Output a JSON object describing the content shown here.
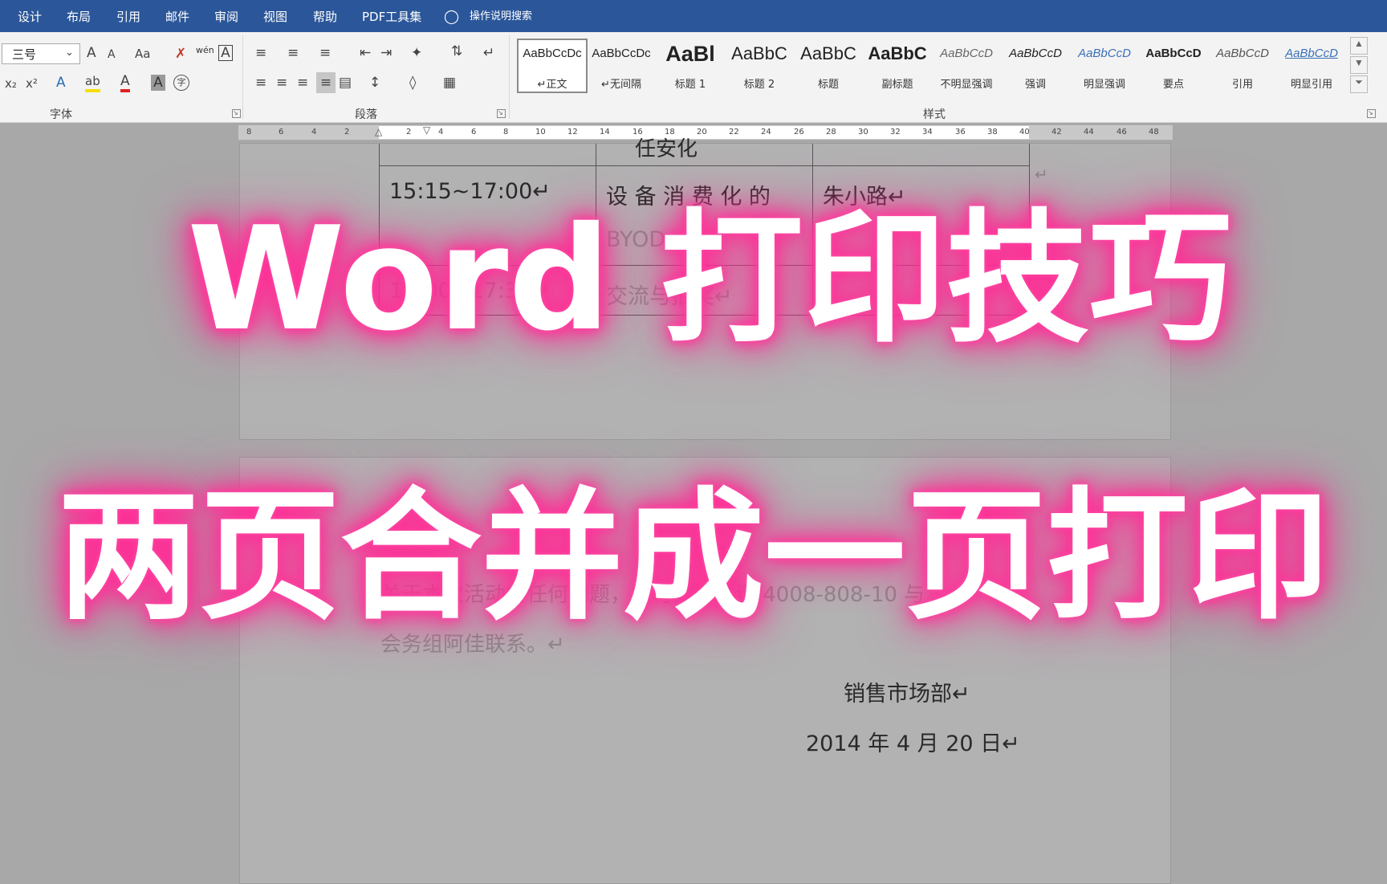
{
  "menubar": {
    "tabs": [
      "设计",
      "布局",
      "引用",
      "邮件",
      "审阅",
      "视图",
      "帮助",
      "PDF工具集"
    ],
    "tell_me": "操作说明搜索"
  },
  "ribbon": {
    "font": {
      "size_value": "三号",
      "grow": "A",
      "shrink": "A",
      "case": "Aa",
      "phonetic": "wén",
      "border_char": "A",
      "subscript": "x₂",
      "superscript": "x²",
      "text_effects": "A",
      "highlight": "ab",
      "font_color": "A",
      "char_shading": "A",
      "enclose": "字",
      "group_label": "字体"
    },
    "paragraph": {
      "group_label": "段落"
    },
    "styles": {
      "group_label": "样式",
      "items": [
        {
          "sample": "AaBbCcDc",
          "name": "↵正文"
        },
        {
          "sample": "AaBbCcDc",
          "name": "↵无间隔"
        },
        {
          "sample": "AaBl",
          "name": "标题 1"
        },
        {
          "sample": "AaBbC",
          "name": "标题 2"
        },
        {
          "sample": "AaBbC",
          "name": "标题"
        },
        {
          "sample": "AaBbC",
          "name": "副标题"
        },
        {
          "sample": "AaBbCcD",
          "name": "不明显强调"
        },
        {
          "sample": "AaBbCcD",
          "name": "强调"
        },
        {
          "sample": "AaBbCcD",
          "name": "明显强调"
        },
        {
          "sample": "AaBbCcD",
          "name": "要点"
        },
        {
          "sample": "AaBbCcD",
          "name": "引用"
        },
        {
          "sample": "AaBbCcD",
          "name": "明显引用"
        }
      ]
    }
  },
  "ruler": {
    "left_ticks": [
      "8",
      "6",
      "4",
      "2"
    ],
    "right_ticks": [
      "2",
      "4",
      "6",
      "8",
      "10",
      "12",
      "14",
      "16",
      "18",
      "20",
      "22",
      "24",
      "26",
      "28",
      "30",
      "32",
      "34",
      "36",
      "38",
      "40",
      "42",
      "44",
      "46",
      "48"
    ]
  },
  "document": {
    "page1": {
      "table_row_top": "任安化",
      "time_cell": "15:15~17:00↵",
      "topic_cell_line1": "设 备 消 费 化 的",
      "topic_cell_line2": "BYOD",
      "speaker_cell": "朱小路↵",
      "time_cell_2": "17:00~17:30↵",
      "topic_cell_2": "交流与抽奖↵"
    },
    "page2": {
      "body_line1": "关于本次活动的任何问题，您可拨打电话 4008-808-10 与",
      "body_line2": "会务组阿佳联系。↵",
      "department": "销售市场部↵",
      "date": "2014 年 4 月 20 日↵"
    }
  },
  "overlay": {
    "title_line1": "Word 打印技巧",
    "title_line2": "两页合并成一页打印"
  },
  "colors": {
    "titlebar": "#2b579a",
    "glow": "#ff2d95"
  }
}
